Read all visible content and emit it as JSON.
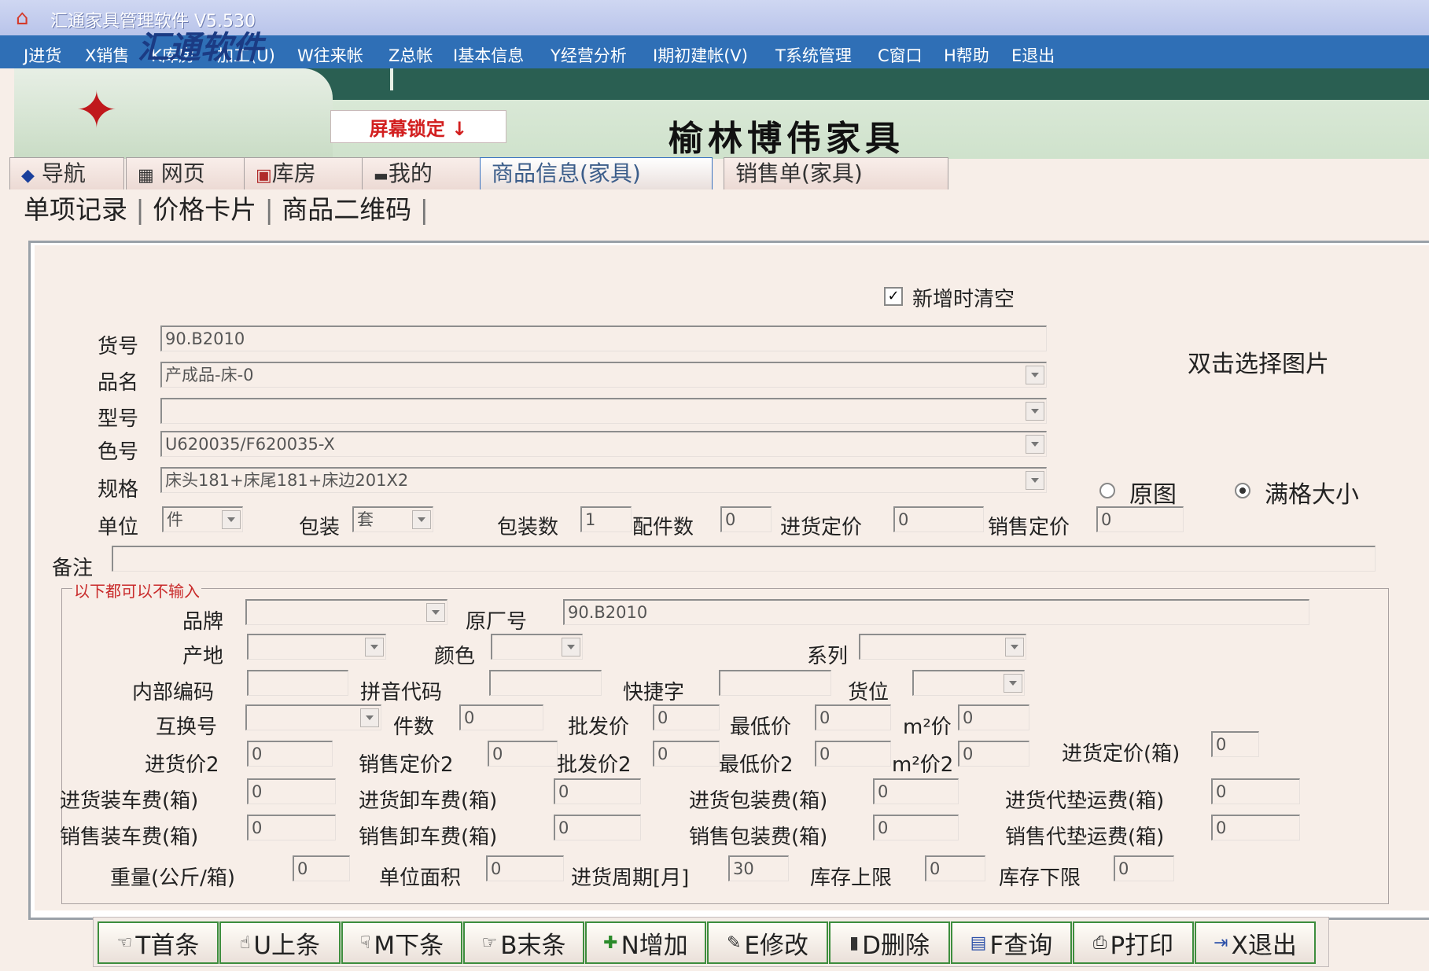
{
  "title": "汇通家具管理软件 V5.530",
  "menu": [
    "J进货",
    "X销售",
    "K库房",
    "加工(U)",
    "W往来帐",
    "Z总帐",
    "I基本信息",
    "Y经营分析",
    "I期初建帐(V)",
    "T系统管理",
    "C窗口",
    "H帮助",
    "E退出"
  ],
  "banner": {
    "logo": "汇通软件",
    "lock": "屏幕锁定 ↓",
    "company": "榆林博伟家具"
  },
  "tabs": [
    "导航",
    "网页",
    "库房",
    "我的",
    "商品信息(家具)",
    "销售单(家具)"
  ],
  "subtabs": [
    "单项记录",
    "价格卡片",
    "商品二维码"
  ],
  "form": {
    "clear_on_add": "新增时清空",
    "pick_image": "双击选择图片",
    "radio_original": "原图",
    "radio_fit": "满格大小",
    "labels": {
      "code": "货号",
      "name": "品名",
      "model": "型号",
      "color_no": "色号",
      "spec": "规格",
      "unit": "单位",
      "pack": "包装",
      "pack_qty": "包装数",
      "parts": "配件数",
      "buy_price": "进货定价",
      "sell_price": "销售定价",
      "remark": "备注"
    },
    "values": {
      "code": "90.B2010",
      "name": "产成品-床-0",
      "model": "",
      "color_no": "U620035/F620035-X",
      "spec": "床头181+床尾181+床边201X2",
      "unit": "件",
      "pack": "套",
      "pack_qty": "1",
      "parts": "0",
      "buy_price": "0",
      "sell_price": "0",
      "remark": ""
    }
  },
  "optional": {
    "title": "以下都可以不输入",
    "labels": {
      "brand": "品牌",
      "factory_no": "原厂号",
      "origin": "产地",
      "color": "颜色",
      "series": "系列",
      "internal": "内部编码",
      "pinyin": "拼音代码",
      "shortcut": "快捷字",
      "location": "货位",
      "exchange": "互换号",
      "pieces": "件数",
      "wholesale": "批发价",
      "min_price": "最低价",
      "m2_price": "m²价",
      "buy2": "进货价2",
      "sell2": "销售定价2",
      "wholesale2": "批发价2",
      "min2": "最低价2",
      "m2_2": "m²价2",
      "buy_box": "进货定价(箱)",
      "buy_load": "进货装车费(箱)",
      "buy_unload": "进货卸车费(箱)",
      "buy_pack": "进货包装费(箱)",
      "buy_freight": "进货代垫运费(箱)",
      "sell_load": "销售装车费(箱)",
      "sell_unload": "销售卸车费(箱)",
      "sell_pack": "销售包装费(箱)",
      "sell_freight": "销售代垫运费(箱)",
      "weight": "重量(公斤/箱)",
      "area": "单位面积",
      "cycle": "进货周期[月]",
      "stock_max": "库存上限",
      "stock_min": "库存下限"
    },
    "values": {
      "brand": "",
      "factory_no": "90.B2010",
      "origin": "",
      "color": "",
      "series": "",
      "internal": "",
      "pinyin": "",
      "shortcut": "",
      "location": "",
      "exchange": "",
      "pieces": "0",
      "wholesale": "0",
      "min_price": "0",
      "m2_price": "0",
      "buy2": "0",
      "sell2": "0",
      "wholesale2": "0",
      "min2": "0",
      "m2_2": "0",
      "buy_box": "0",
      "buy_load": "0",
      "buy_unload": "0",
      "buy_pack": "0",
      "buy_freight": "0",
      "sell_load": "0",
      "sell_unload": "0",
      "sell_pack": "0",
      "sell_freight": "0",
      "weight": "0",
      "area": "0",
      "cycle": "30",
      "stock_max": "0",
      "stock_min": "0"
    }
  },
  "buttons": [
    "T首条",
    "U上条",
    "M下条",
    "B末条",
    "N增加",
    "E修改",
    "D删除",
    "F查询",
    "P打印",
    "X退出"
  ],
  "colors": {
    "menubar": "#2f6fb6",
    "banner": "#2a5f52",
    "accent_red": "#d21f1f"
  }
}
